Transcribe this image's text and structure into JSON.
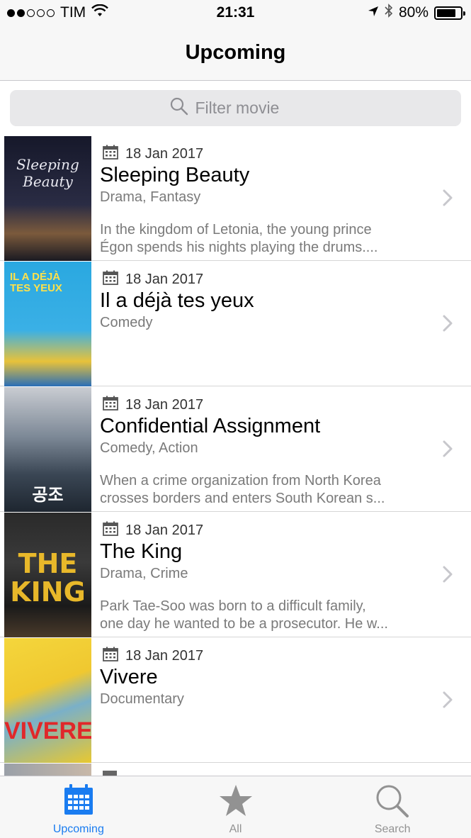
{
  "status_bar": {
    "carrier": "TIM",
    "time": "21:31",
    "battery": "80%",
    "battery_level": 0.8,
    "signal_dots_filled": 2,
    "signal_dots_total": 5
  },
  "nav": {
    "title": "Upcoming"
  },
  "search": {
    "placeholder": "Filter movie",
    "value": ""
  },
  "movies": [
    {
      "date": "18 Jan 2017",
      "title": "Sleeping Beauty",
      "genre": "Drama, Fantasy",
      "desc_line1": "In the kingdom of Letonia, the young prince",
      "desc_line2": "Égon spends his nights playing the drums....",
      "poster_text": "Sleeping Beauty",
      "poster_color": "#1a1c2c"
    },
    {
      "date": "18 Jan 2017",
      "title": "Il a déjà tes yeux",
      "genre": "Comedy",
      "desc_line1": "",
      "desc_line2": "",
      "poster_text": "IL A DÉJÀ TES YEUX",
      "poster_color": "#2aa0d8"
    },
    {
      "date": "18 Jan 2017",
      "title": "Confidential Assignment",
      "genre": "Comedy, Action",
      "desc_line1": "When a crime organization from North Korea",
      "desc_line2": "crosses borders and enters South Korean s...",
      "poster_text": "공조",
      "poster_color": "#3a4a5a"
    },
    {
      "date": "18 Jan 2017",
      "title": "The King",
      "genre": "Drama, Crime",
      "desc_line1": "Park Tae-Soo was born to a difficult family,",
      "desc_line2": "one day he wanted to be a prosecutor. He w...",
      "poster_text": "THE KING",
      "poster_color": "#1b1b1b"
    },
    {
      "date": "18 Jan 2017",
      "title": "Vivere",
      "genre": "Documentary",
      "desc_line1": "",
      "desc_line2": "",
      "poster_text": "VIVERE",
      "poster_color": "#f2d23a"
    }
  ],
  "tabs": [
    {
      "label": "Upcoming",
      "icon": "calendar-icon",
      "active": true
    },
    {
      "label": "All",
      "icon": "star-icon",
      "active": false
    },
    {
      "label": "Search",
      "icon": "magnifier-icon",
      "active": false
    }
  ],
  "colors": {
    "accent": "#1a7cf0",
    "inactive": "#929292",
    "secondary_text": "#7a7a7a"
  }
}
